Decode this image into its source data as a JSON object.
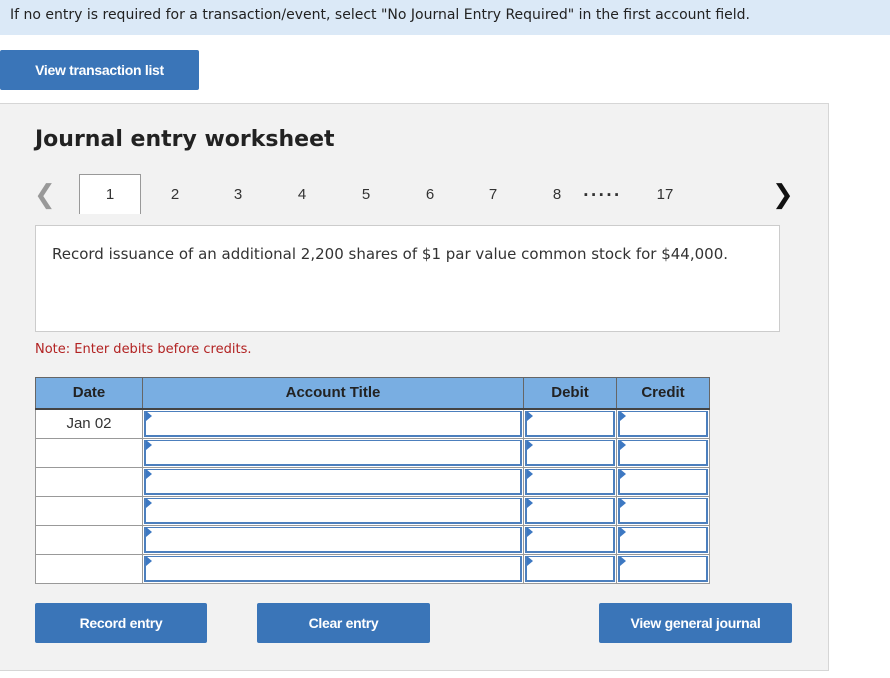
{
  "banner": {
    "text": "If no entry is required for a transaction/event, select \"No Journal Entry Required\" in the first account field."
  },
  "buttons": {
    "view_transaction_list": "View transaction list",
    "record_entry": "Record entry",
    "clear_entry": "Clear entry",
    "view_general_journal": "View general journal"
  },
  "worksheet": {
    "title": "Journal entry worksheet",
    "pager": {
      "prev_icon": "chevron-left-icon",
      "next_icon": "chevron-right-icon",
      "pages": [
        "1",
        "2",
        "3",
        "4",
        "5",
        "6",
        "7",
        "8"
      ],
      "ellipsis": ".....",
      "last_page": "17",
      "active_page": "1"
    },
    "description": "Record issuance of an additional 2,200 shares of $1 par value common stock for $44,000.",
    "note": "Note: Enter debits before credits."
  },
  "journal": {
    "columns": [
      "Date",
      "Account Title",
      "Debit",
      "Credit"
    ],
    "rows": [
      {
        "date": "Jan 02",
        "account": "",
        "debit": "",
        "credit": ""
      },
      {
        "date": "",
        "account": "",
        "debit": "",
        "credit": ""
      },
      {
        "date": "",
        "account": "",
        "debit": "",
        "credit": ""
      },
      {
        "date": "",
        "account": "",
        "debit": "",
        "credit": ""
      },
      {
        "date": "",
        "account": "",
        "debit": "",
        "credit": ""
      },
      {
        "date": "",
        "account": "",
        "debit": "",
        "credit": ""
      }
    ]
  }
}
